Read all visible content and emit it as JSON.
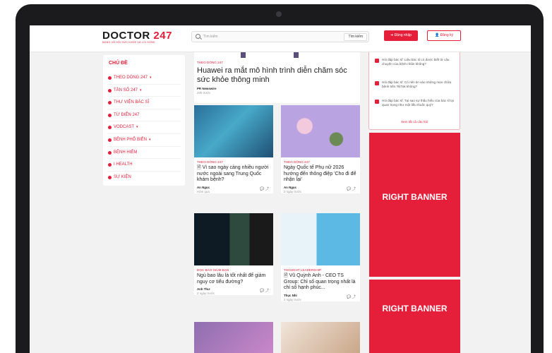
{
  "header": {
    "logo_main": "DOCTOR",
    "logo_num": "247",
    "tagline": "MẠNG XÃ HỘI SỨC KHỎE VÀ LỐI SỐNG",
    "search_placeholder": "Tìm kiếm",
    "search_button": "Tìm kiếm",
    "login": "Đăng nhập",
    "register": "Đăng ký"
  },
  "sidebar": {
    "title": "CHỦ ĐỀ",
    "items": [
      {
        "label": "THEO DÒNG 247",
        "chev": "▾"
      },
      {
        "label": "TẦN SỐ 247",
        "chev": "▾"
      },
      {
        "label": "THƯ VIỆN BÁC SĨ",
        "chev": ""
      },
      {
        "label": "TỪ ĐIỂN 247",
        "chev": ""
      },
      {
        "label": "VODCAST",
        "chev": "▾"
      },
      {
        "label": "BỆNH PHỔ BIẾN",
        "chev": "▾"
      },
      {
        "label": "BỆNH HIẾM",
        "chev": ""
      },
      {
        "label": "I HEALTH",
        "chev": ""
      },
      {
        "label": "SỰ KIỆN",
        "chev": ""
      }
    ]
  },
  "featured": {
    "category": "THEO DÒNG 247",
    "title": "Huawei ra mắt mô hình trình diễn chăm sóc sức khỏe thông minh",
    "author": "PR Newswire",
    "time": "20h trước"
  },
  "articles": [
    {
      "category": "THEO DÒNG 247",
      "title": "🗎 Vì sao ngày càng nhiều người nước ngoài sang Trung Quốc khám bệnh?",
      "author": "An Ngọc",
      "time": "Hôm qua"
    },
    {
      "category": "THEO DÒNG 247",
      "title": "Ngày Quốc tế Phụ nữ 2026 hướng đến thông điệp 'Cho đi để nhận lại'",
      "author": "An Ngọc",
      "time": "2 ngày trước"
    },
    {
      "category": "ĐỌC BÁO GIÙM BẠN",
      "title": "Ngủ bao lâu là tốt nhất để giảm nguy cơ tiểu đường?",
      "author": "Anh Thư",
      "time": "2 ngày trước"
    },
    {
      "category": "THOUGHT LEADERSHIP",
      "title": "🗎 Vũ Quỳnh Anh - CEO TS Group: Chỉ số quan trọng nhất là chỉ số hạnh phúc...",
      "author": "Thục Nhi",
      "time": "2 ngày trước"
    }
  ],
  "faq": {
    "questions": [
      "Hỏi đáp bác sĩ: Liệu bác sĩ có được biết từ câu chuyện của bệnh nhân không?",
      "Hỏi đáp bác sĩ: Có nên tin vào những mẹo chữa bệnh trên TikTok không?",
      "Hỏi đáp bác sĩ: Tại sao sự thấu hiểu của bác sĩ lại quan trọng như một liều thuốc quý?"
    ],
    "all": "Xem tất cả câu hỏi"
  },
  "banners": [
    "RIGHT BANNER",
    "RIGHT BANNER"
  ],
  "colors": {
    "brand": "#e51e3a"
  }
}
